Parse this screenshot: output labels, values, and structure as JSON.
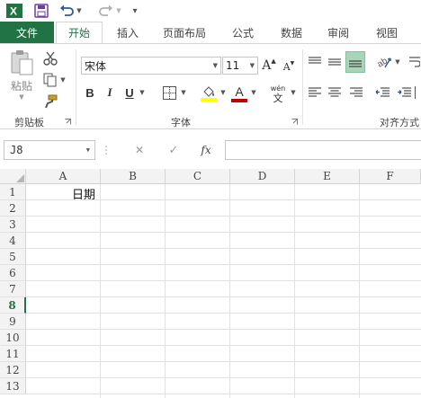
{
  "qat": {
    "customize_glyph": "▾"
  },
  "tabs": {
    "file": "文件",
    "items": [
      "开始",
      "插入",
      "页面布局",
      "公式",
      "数据",
      "审阅",
      "视图"
    ]
  },
  "ribbon": {
    "clipboard": {
      "paste_label": "粘贴",
      "group_label": "剪贴板"
    },
    "font": {
      "font_name": "宋体",
      "font_size": "11",
      "bold": "B",
      "italic": "I",
      "underline": "U",
      "grow_font": "A",
      "shrink_font": "A",
      "font_color_glyph": "A",
      "phonetic_top": "wén",
      "phonetic_bottom": "文",
      "group_label": "字体"
    },
    "alignment": {
      "group_label": "对齐方式"
    }
  },
  "formula_bar": {
    "name_box": "J8",
    "cancel_glyph": "✕",
    "enter_glyph": "✓",
    "fx_label": "fx",
    "dots": "⋮",
    "content": ""
  },
  "grid": {
    "columns": [
      "A",
      "B",
      "C",
      "D",
      "E",
      "F"
    ],
    "rows": [
      "1",
      "2",
      "3",
      "4",
      "5",
      "6",
      "7",
      "8",
      "9",
      "10",
      "11",
      "12",
      "13"
    ],
    "selected_row": "8",
    "cells": {
      "A1": "日期"
    }
  },
  "colors": {
    "accent": "#217346",
    "highlight_yellow": "#ffff00",
    "font_red": "#c00000"
  }
}
